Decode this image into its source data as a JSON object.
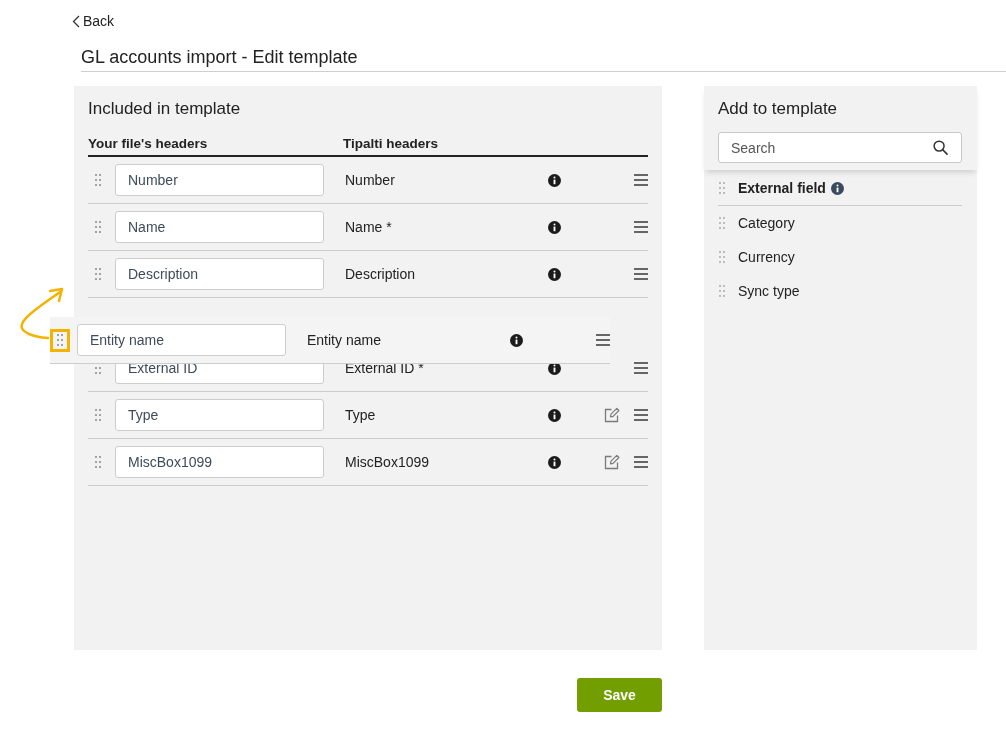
{
  "back_link": {
    "label": "Back"
  },
  "page": {
    "title": "GL accounts import - Edit template"
  },
  "included_panel": {
    "title": "Included in template",
    "columns": [
      "Your file's headers",
      "Tipalti headers"
    ],
    "rows": [
      {
        "kind": "field",
        "value": "Number",
        "tipalti_header": "Number",
        "editable": false
      },
      {
        "kind": "field",
        "value": "Name",
        "tipalti_header": "Name *",
        "editable": false
      },
      {
        "kind": "field",
        "value": "Description",
        "tipalti_header": "Description",
        "editable": false
      },
      {
        "kind": "drop-slot"
      },
      {
        "kind": "field",
        "value": "External ID",
        "tipalti_header": "External ID *",
        "editable": false
      },
      {
        "kind": "field",
        "value": "Type",
        "tipalti_header": "Type",
        "editable": true
      },
      {
        "kind": "field",
        "value": "MiscBox1099",
        "tipalti_header": "MiscBox1099",
        "editable": true
      }
    ]
  },
  "dragged_row": {
    "value": "Entity name",
    "tipalti_header": "Entity name",
    "editable": false,
    "handle_highlighted": true
  },
  "add_panel": {
    "title": "Add to template",
    "search": {
      "placeholder": "Search"
    },
    "items": [
      {
        "kind": "group-header",
        "label": "External field"
      },
      {
        "kind": "field",
        "label": "Category"
      },
      {
        "kind": "field",
        "label": "Currency"
      },
      {
        "kind": "field",
        "label": "Sync type"
      }
    ]
  },
  "save_button": {
    "label": "Save"
  }
}
